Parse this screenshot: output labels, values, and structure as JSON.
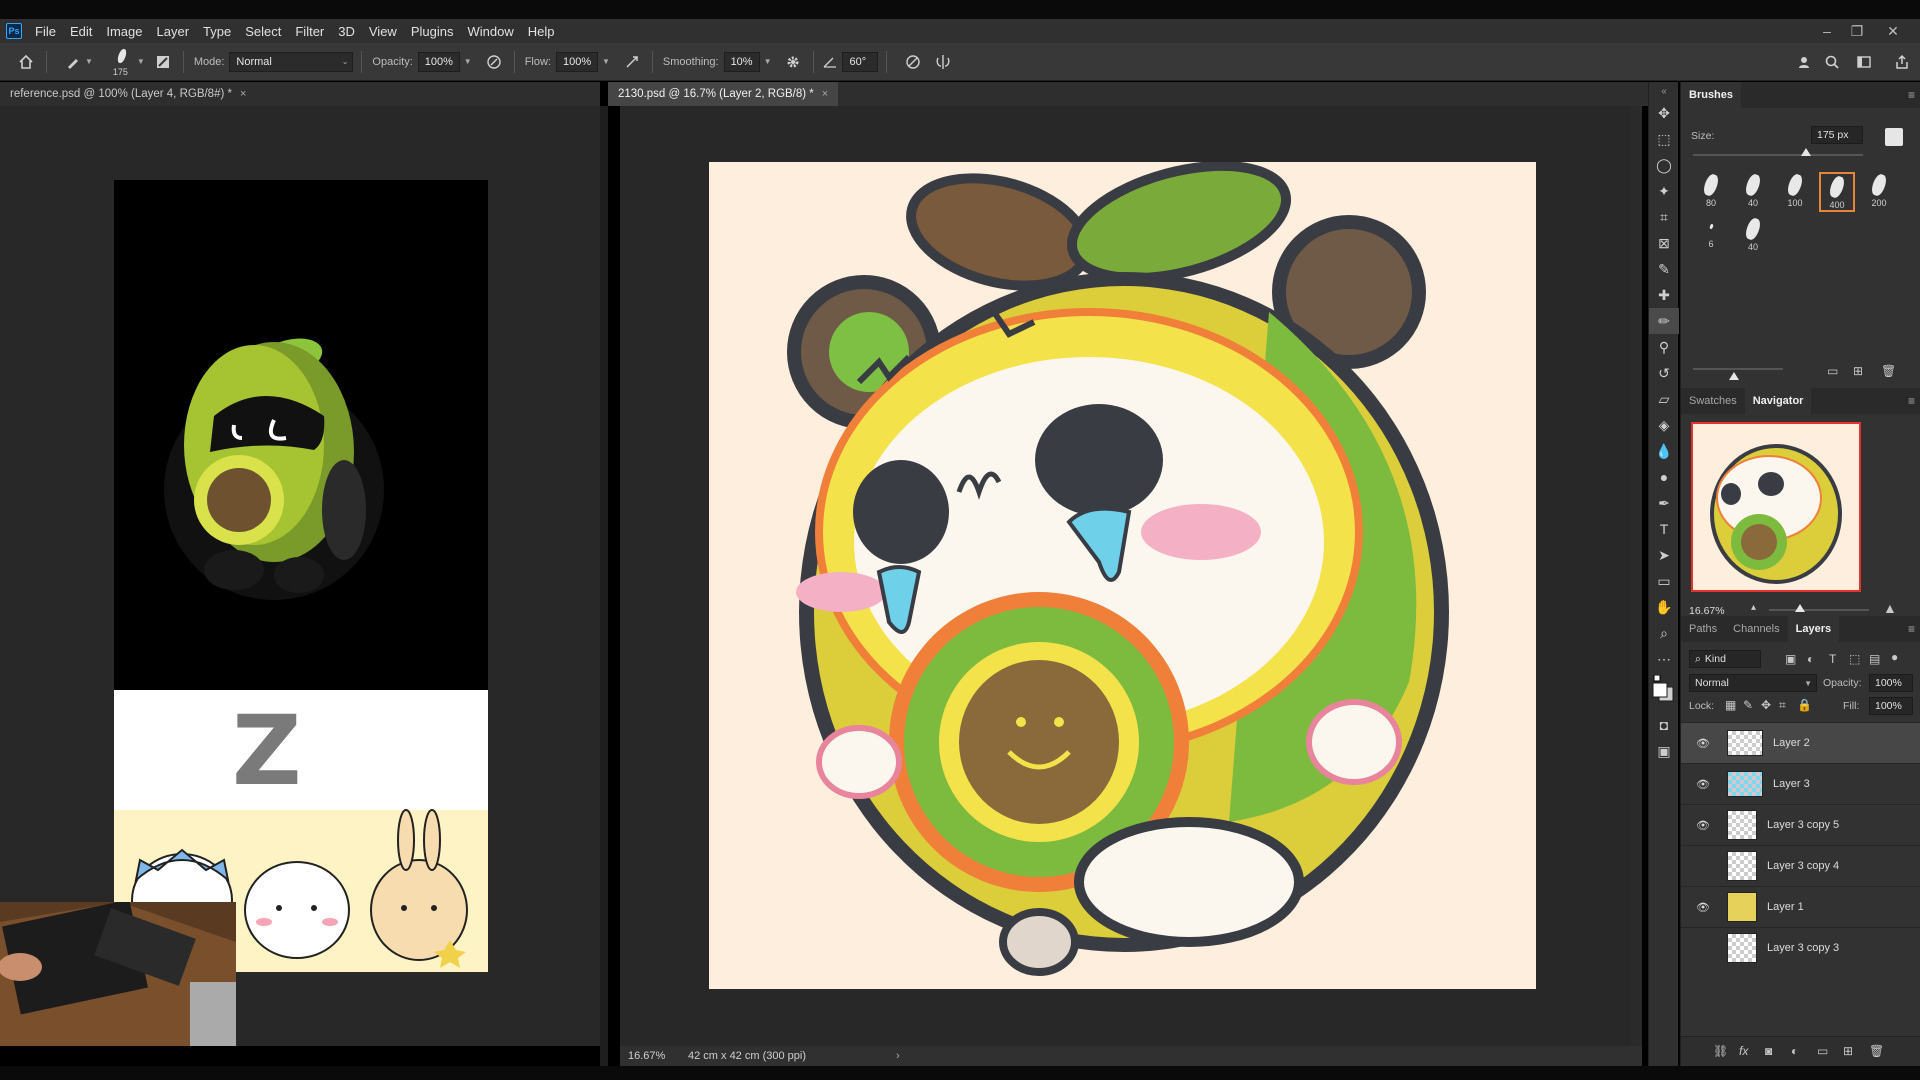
{
  "app": {
    "logo": "Ps",
    "menu": [
      "File",
      "Edit",
      "Image",
      "Layer",
      "Type",
      "Select",
      "Filter",
      "3D",
      "View",
      "Plugins",
      "Window",
      "Help"
    ],
    "window_controls": [
      "–",
      "❐",
      "✕"
    ]
  },
  "options": {
    "brush_size": "175",
    "mode_label": "Mode:",
    "mode_value": "Normal",
    "opacity_label": "Opacity:",
    "opacity_value": "100%",
    "flow_label": "Flow:",
    "flow_value": "100%",
    "smoothing_label": "Smoothing:",
    "smoothing_value": "10%",
    "angle_value": "60°"
  },
  "tabs": {
    "left": "reference.psd @ 100% (Layer 4, RGB/8#) *",
    "right": "2130.psd @ 16.7% (Layer 2, RGB/8) *",
    "close": "×"
  },
  "status": {
    "zoom": "16.67%",
    "doc_size": "42 cm x 42 cm (300 ppi)",
    "arrow": "›"
  },
  "brushes_panel": {
    "title": "Brushes",
    "size_label": "Size:",
    "size_value": "175 px",
    "tips": [
      "80",
      "40",
      "100",
      "400",
      "200",
      "6",
      "40"
    ],
    "selected_tip": "400"
  },
  "navigator_panel": {
    "tabs": [
      "Swatches",
      "Navigator"
    ],
    "zoom": "16.67%"
  },
  "layers_panel": {
    "tabs": [
      "Paths",
      "Channels",
      "Layers"
    ],
    "kind_label": "Kind",
    "blend_mode": "Normal",
    "opacity_label": "Opacity:",
    "opacity_value": "100%",
    "lock_label": "Lock:",
    "fill_label": "Fill:",
    "fill_value": "100%",
    "layers": [
      {
        "name": "Layer 2",
        "visible": true,
        "selected": true
      },
      {
        "name": "Layer 3",
        "visible": true,
        "selected": false
      },
      {
        "name": "Layer 3 copy 5",
        "visible": true,
        "selected": false
      },
      {
        "name": "Layer 3 copy 4",
        "visible": false,
        "selected": false
      },
      {
        "name": "Layer 1",
        "visible": true,
        "selected": false
      },
      {
        "name": "Layer 3 copy 3",
        "visible": false,
        "selected": false
      }
    ]
  },
  "reference": {
    "scribble": "Z"
  },
  "colors": {
    "canvas_bg": "#fdeedd",
    "accent": "#e8833a",
    "ps_blue": "#31a8ff"
  }
}
